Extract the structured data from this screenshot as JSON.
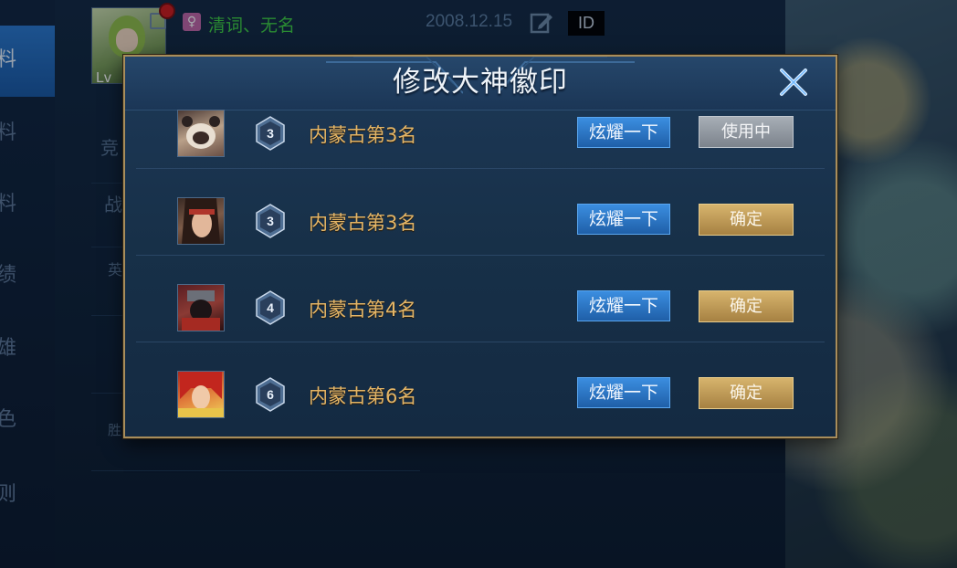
{
  "background": {
    "side_tabs": [
      "料",
      "料",
      "料",
      "绩",
      "雄",
      "色",
      "则"
    ],
    "mid_tabs": [
      "竞",
      "战",
      "英"
    ],
    "player": {
      "avatar_level": "Lv",
      "gender_symbol": "♀",
      "name": "清词、无名",
      "date": "2008.12.15",
      "id_label": "ID"
    },
    "bottom_label": "胜"
  },
  "modal": {
    "title": "修改大神徽印",
    "close_icon": "close-icon",
    "rows": [
      {
        "rank_number": "3",
        "rank_text": "内蒙古第3名",
        "show_label": "炫耀一下",
        "status_label": "使用中",
        "status": "in-use"
      },
      {
        "rank_number": "3",
        "rank_text": "内蒙古第3名",
        "show_label": "炫耀一下",
        "status_label": "确定",
        "status": "confirm"
      },
      {
        "rank_number": "4",
        "rank_text": "内蒙古第4名",
        "show_label": "炫耀一下",
        "status_label": "确定",
        "status": "confirm"
      },
      {
        "rank_number": "6",
        "rank_text": "内蒙古第6名",
        "show_label": "炫耀一下",
        "status_label": "确定",
        "status": "confirm"
      }
    ]
  },
  "colors": {
    "accent_gold": "#a88d5b",
    "rank_text": "#e3b567",
    "button_blue": "#2f7dd0",
    "button_gold": "#c9a45f",
    "button_gray": "#8f969e",
    "name_green": "#3fd043"
  }
}
